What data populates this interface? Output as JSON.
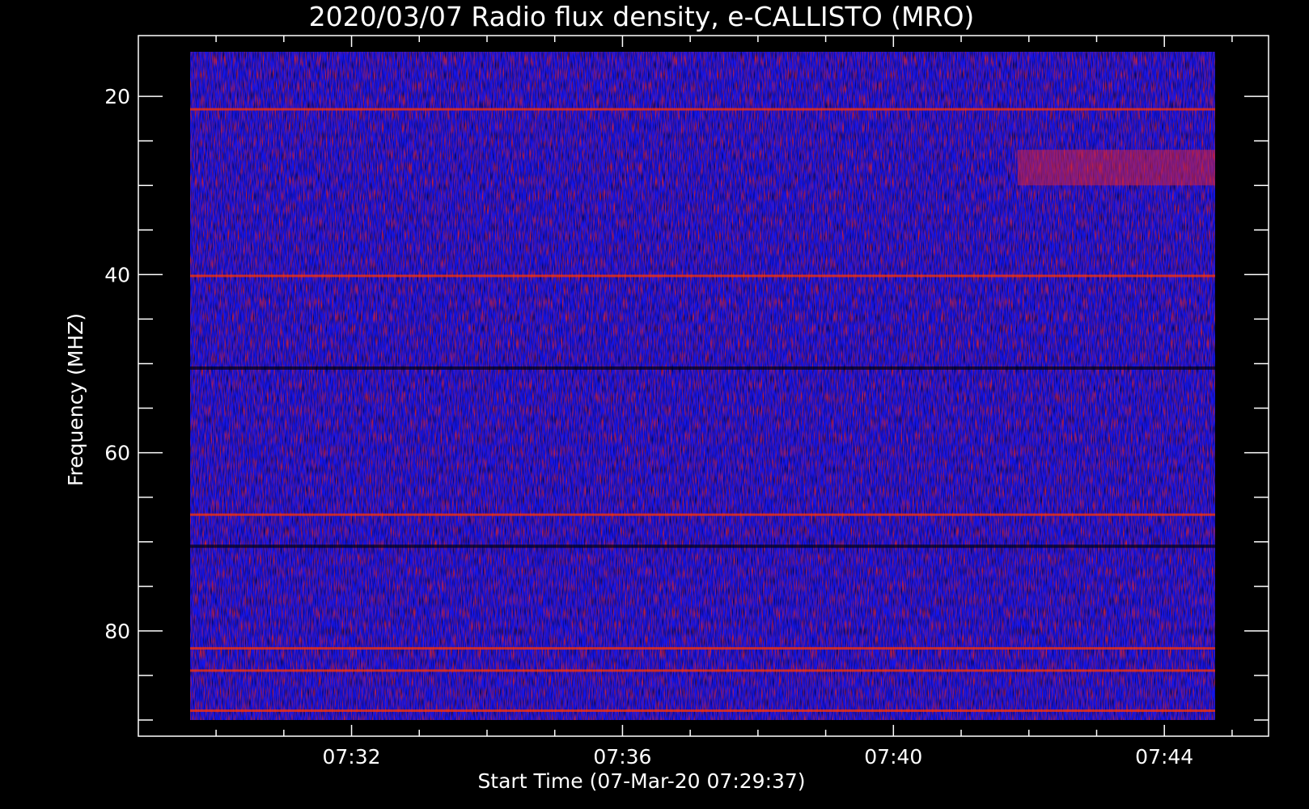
{
  "chart_data": {
    "type": "heatmap",
    "title": "2020/03/07  Radio flux density, e-CALLISTO (MRO)",
    "xlabel": "Start Time (07-Mar-20 07:29:37)",
    "ylabel": "Frequency (MHZ)",
    "x_range": [
      "07:29:37",
      "07:44:45"
    ],
    "y_range": [
      15,
      90
    ],
    "y_inverted": true,
    "x_major_ticks": [
      "07:32",
      "07:36",
      "07:40",
      "07:44"
    ],
    "x_minor_ticks": [
      "07:30",
      "07:31",
      "07:32",
      "07:33",
      "07:34",
      "07:35",
      "07:36",
      "07:37",
      "07:38",
      "07:39",
      "07:40",
      "07:41",
      "07:42",
      "07:43",
      "07:44",
      "07:45"
    ],
    "y_major_ticks": [
      20,
      40,
      60,
      80
    ],
    "y_minor_ticks": [
      20,
      25,
      30,
      35,
      40,
      45,
      50,
      55,
      60,
      65,
      70,
      75,
      80,
      85,
      90
    ],
    "colormap": {
      "low": "#000000",
      "mid": "#1a1aff",
      "high": "#ff2a00",
      "peak": "#ffff80"
    },
    "background": "#0000cc",
    "bright_bands_mhz": [
      21.5,
      40.2,
      67,
      82,
      84.5,
      89
    ],
    "dark_bands_mhz": [
      50.5,
      70.5
    ],
    "interference_patch": {
      "time_start": "07:41:50",
      "time_end": "07:44:45",
      "freq_start": 26,
      "freq_end": 30
    }
  }
}
